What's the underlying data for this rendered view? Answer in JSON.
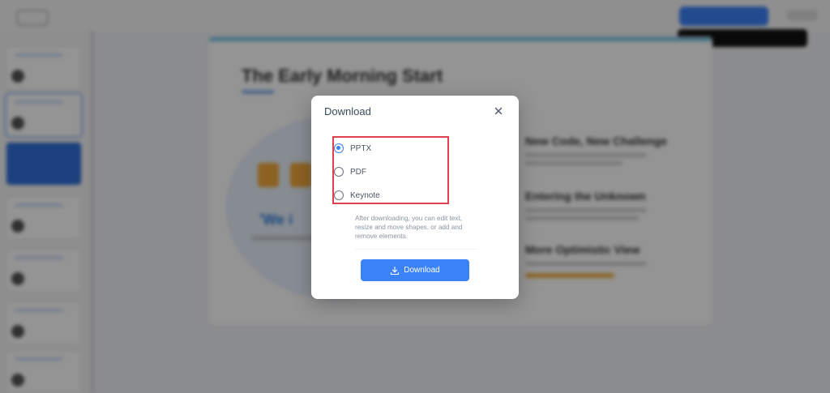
{
  "background": {
    "slide_title": "The Early Morning Start",
    "quote_text": "'We i",
    "sections": [
      "New Code, New Challenge",
      "Entering the Unknown",
      "More Optimistic View"
    ]
  },
  "dialog": {
    "title": "Download",
    "options": [
      {
        "label": "PPTX",
        "checked": true
      },
      {
        "label": "PDF",
        "checked": false
      },
      {
        "label": "Keynote",
        "checked": false
      }
    ],
    "help_text": "After downloading, you can edit text, resize and move shapes, or add and remove elements.",
    "download_label": "Download"
  },
  "colors": {
    "accent": "#3b82f6",
    "highlight_border": "#e0424d"
  },
  "icons": {
    "close": "close-icon",
    "download": "download-icon"
  }
}
